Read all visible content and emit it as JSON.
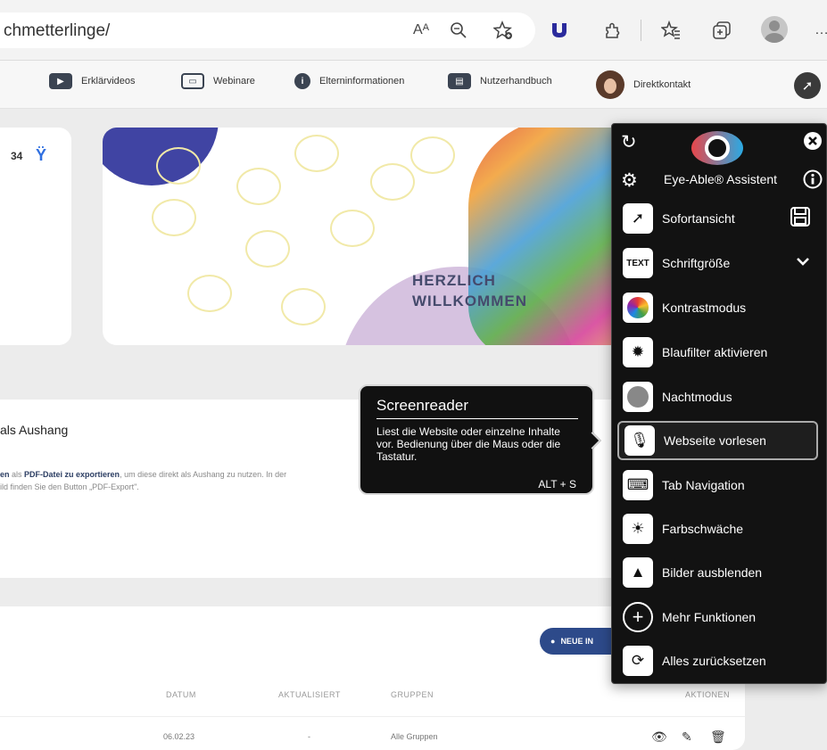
{
  "browser": {
    "url": "chmetterlinge/",
    "icons": [
      "read-aloud-icon",
      "zoom-icon",
      "add-favorite-icon",
      "extension-u-icon",
      "extensions-icon",
      "favorites-icon",
      "collections-icon",
      "profile-icon",
      "more-icon"
    ],
    "read_aloud_glyph": "Aᴬ",
    "more_glyph": "…"
  },
  "nav": {
    "items": [
      {
        "label": "Erklärvideos",
        "icon": "play-icon"
      },
      {
        "label": "Webinare",
        "icon": "webinar-icon"
      },
      {
        "label": "Elterninformationen",
        "icon": "info-icon"
      },
      {
        "label": "Nutzerhandbuch",
        "icon": "book-icon"
      },
      {
        "label": "Direktkontakt",
        "icon": "avatar"
      }
    ]
  },
  "dashboard": {
    "kids_count": "34",
    "welcome_line1": "HERZLICH",
    "welcome_line2": "WILLKOMMEN"
  },
  "aushang": {
    "title": "als Aushang",
    "line1_start": "en",
    "line1_mid": " als ",
    "line1_bold": "PDF-Datei zu exportieren",
    "line1_end": ", um diese direkt als Aushang zu nutzen. In der",
    "line2": "ild finden Sie den Button „PDF-Export\"."
  },
  "table": {
    "new_button": "NEUE IN",
    "headers": [
      "DATUM",
      "AKTUALISIERT",
      "GRUPPEN",
      "AKTIONEN"
    ],
    "row": {
      "datum": "06.02.23",
      "aktualisiert": "-",
      "gruppen": "Alle Gruppen"
    }
  },
  "eye_able": {
    "title": "Eye-Able® Assistent",
    "items": [
      {
        "label": "Sofortansicht",
        "icon": "rocket-icon"
      },
      {
        "label": "Schriftgröße",
        "icon": "text-size-icon"
      },
      {
        "label": "Kontrastmodus",
        "icon": "contrast-icon"
      },
      {
        "label": "Blaufilter aktivieren",
        "icon": "blue-filter-icon"
      },
      {
        "label": "Nachtmodus",
        "icon": "night-mode-icon"
      },
      {
        "label": "Webseite vorlesen",
        "icon": "read-aloud-icon"
      },
      {
        "label": "Tab Navigation",
        "icon": "keyboard-icon"
      },
      {
        "label": "Farbschwäche",
        "icon": "color-weakness-icon"
      },
      {
        "label": "Bilder ausblenden",
        "icon": "image-icon"
      },
      {
        "label": "Mehr Funktionen",
        "icon": "plus-icon"
      },
      {
        "label": "Alles zurücksetzen",
        "icon": "reset-icon"
      }
    ],
    "active_item": "Webseite vorlesen"
  },
  "tooltip": {
    "title": "Screenreader",
    "body": "Liest die Website oder einzelne Inhalte vor. Bedienung über die Maus oder die Tastatur.",
    "shortcut": "ALT + S"
  },
  "colors": {
    "panel_bg": "#121212",
    "new_button": "#2d4a8a",
    "accent_blue": "#2f6fe0"
  }
}
